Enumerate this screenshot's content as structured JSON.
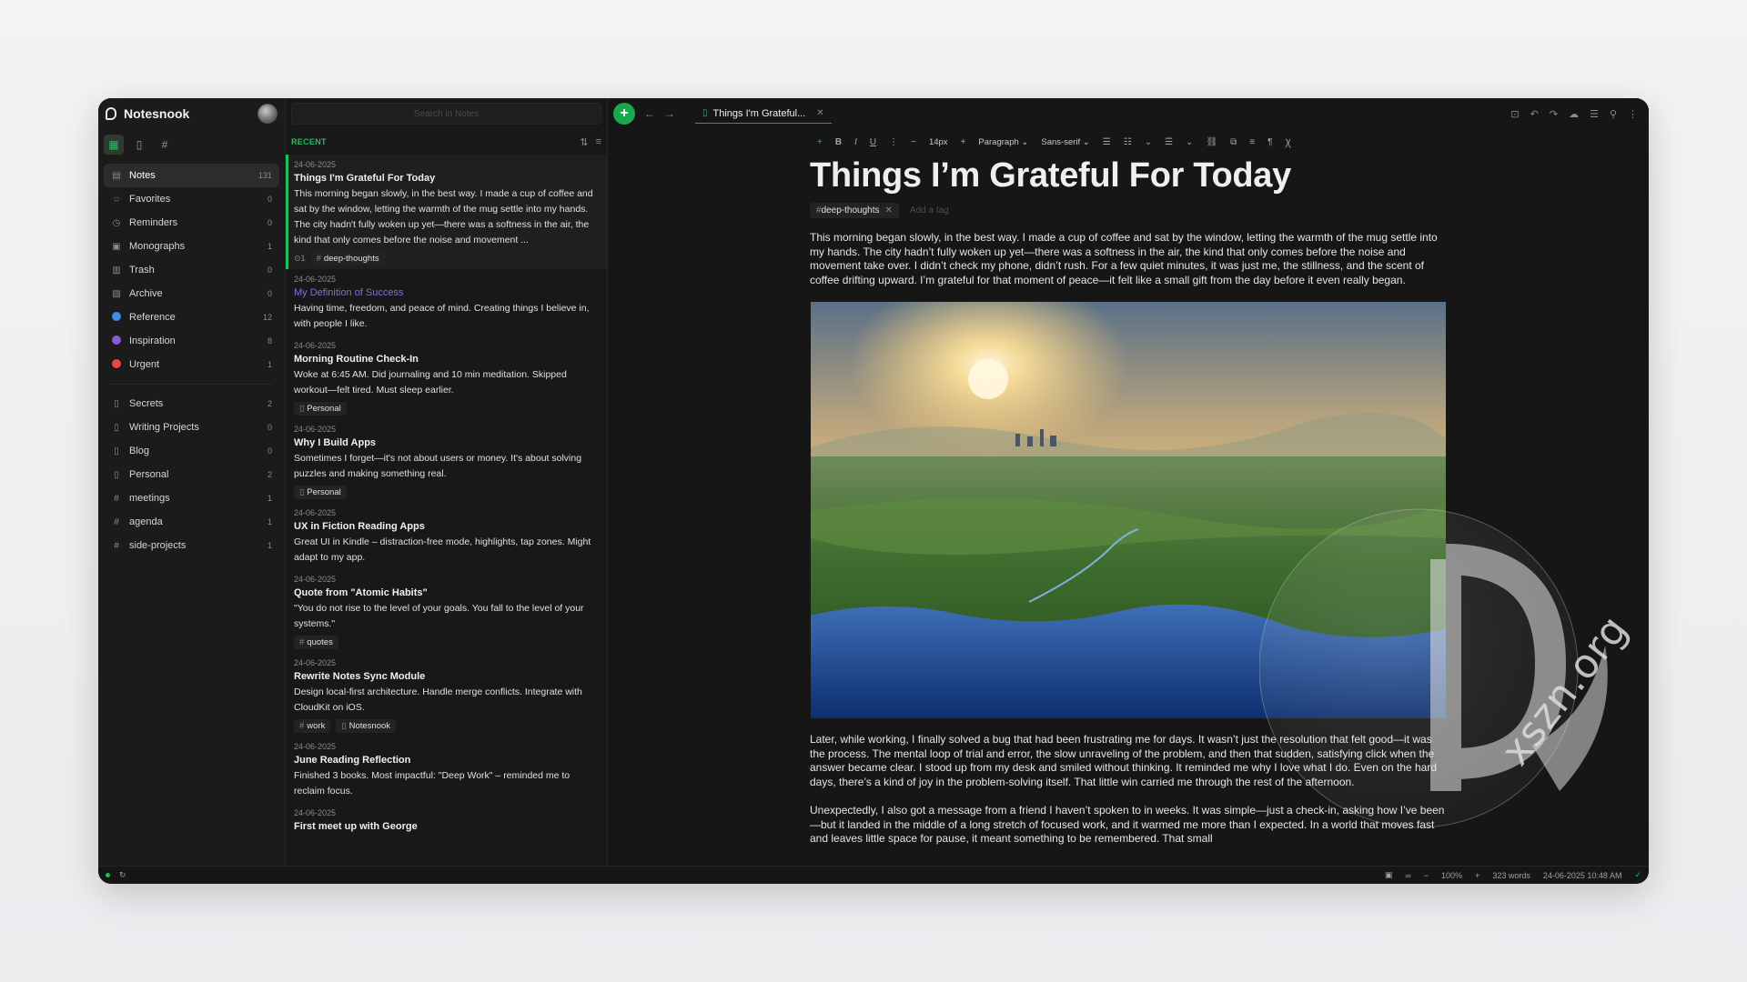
{
  "app": {
    "name": "Notesnook"
  },
  "sidebar": {
    "items": [
      {
        "label": "Notes",
        "count": "131",
        "icon": "note-icon"
      },
      {
        "label": "Favorites",
        "count": "0",
        "icon": "star-icon"
      },
      {
        "label": "Reminders",
        "count": "0",
        "icon": "clock-icon"
      },
      {
        "label": "Monographs",
        "count": "1",
        "icon": "monograph-icon"
      },
      {
        "label": "Trash",
        "count": "0",
        "icon": "trash-icon"
      },
      {
        "label": "Archive",
        "count": "0",
        "icon": "archive-icon"
      }
    ],
    "colors": [
      {
        "label": "Reference",
        "count": "12",
        "color": "#3b8ee8"
      },
      {
        "label": "Inspiration",
        "count": "8",
        "color": "#8b5cd6"
      },
      {
        "label": "Urgent",
        "count": "1",
        "color": "#e84545"
      }
    ],
    "notebooks": [
      {
        "label": "Secrets",
        "count": "2"
      },
      {
        "label": "Writing Projects",
        "count": "0"
      },
      {
        "label": "Blog",
        "count": "0"
      },
      {
        "label": "Personal",
        "count": "2"
      }
    ],
    "tags": [
      {
        "label": "meetings",
        "count": "1"
      },
      {
        "label": "agenda",
        "count": "1"
      },
      {
        "label": "side-projects",
        "count": "1"
      }
    ]
  },
  "notelist": {
    "search_placeholder": "Search in Notes",
    "section": "RECENT",
    "notes": [
      {
        "date": "24-06-2025",
        "title": "Things I'm Grateful For Today",
        "body": "This morning began slowly, in the best way. I made a cup of coffee and sat by the window, letting the warmth of the mug settle into my hands. The city hadn't fully woken up yet—there was a softness in the air, the kind that only comes before the noise and movement ...",
        "meta": "1",
        "tags": [
          "deep-thoughts"
        ]
      },
      {
        "date": "24-06-2025",
        "title": "My Definition of Success",
        "body": "Having time, freedom, and peace of mind. Creating things I believe in, with people I like.",
        "tags": []
      },
      {
        "date": "24-06-2025",
        "title": "Morning Routine Check-In",
        "body": "Woke at 6:45 AM. Did journaling and 10 min meditation. Skipped workout—felt tired. Must sleep earlier.",
        "notebooks": [
          "Personal"
        ]
      },
      {
        "date": "24-06-2025",
        "title": "Why I Build Apps",
        "body": "Sometimes I forget—it's not about users or money. It's about solving puzzles and making something real.",
        "notebooks": [
          "Personal"
        ]
      },
      {
        "date": "24-06-2025",
        "title": "UX in Fiction Reading Apps",
        "body": "Great UI in Kindle – distraction-free mode, highlights, tap zones. Might adapt to my app."
      },
      {
        "date": "24-06-2025",
        "title": "Quote from \"Atomic Habits\"",
        "body": "\"You do not rise to the level of your goals. You fall to the level of your systems.\"",
        "tags": [
          "quotes"
        ]
      },
      {
        "date": "24-06-2025",
        "title": "Rewrite Notes Sync Module",
        "body": "Design local-first architecture. Handle merge conflicts. Integrate with CloudKit on iOS.",
        "tags": [
          "work"
        ],
        "notebooks": [
          "Notesnook"
        ]
      },
      {
        "date": "24-06-2025",
        "title": "June Reading Reflection",
        "body": "Finished 3 books. Most impactful: \"Deep Work\" – reminded me to reclaim focus."
      },
      {
        "date": "24-06-2025",
        "title": "First meet up with George",
        "body": ""
      }
    ]
  },
  "editor": {
    "tab_title": "Things I'm Grateful...",
    "toolbar": {
      "font_size": "14px",
      "block": "Paragraph",
      "font": "Sans-serif"
    },
    "title": "Things I’m Grateful For Today",
    "tag": "deep-thoughts",
    "add_tag_placeholder": "Add a tag",
    "paragraphs": [
      "This morning began slowly, in the best way. I made a cup of coffee and sat by the window, letting the warmth of the mug settle into my hands. The city hadn’t fully woken up yet—there was a softness in the air, the kind that only comes before the noise and movement take over. I didn’t check my phone, didn’t rush. For a few quiet minutes, it was just me, the stillness, and the scent of coffee drifting upward. I’m grateful for that moment of peace—it felt like a small gift from the day before it even really began.",
      "Later, while working, I finally solved a bug that had been frustrating me for days. It wasn’t just the resolution that felt good—it was the process. The mental loop of trial and error, the slow unraveling of the problem, and then that sudden, satisfying click when the answer became clear. I stood up from my desk and smiled without thinking. It reminded me why I love what I do. Even on the hard days, there’s a kind of joy in the problem-solving itself. That little win carried me through the rest of the afternoon.",
      "Unexpectedly, I also got a message from a friend I haven’t spoken to in weeks. It was simple—just a check-in, asking how I’ve been—but it landed in the middle of a long stretch of focused work, and it warmed me more than I expected. In a world that moves fast and leaves little space for pause, it meant something to be remembered. That small"
    ]
  },
  "statusbar": {
    "zoom": "100%",
    "words": "323 words",
    "timestamp": "24-06-2025 10:48 AM"
  },
  "watermark": "xszn.org",
  "colors": {
    "accent": "#1fbf5f",
    "bg": "#161616"
  }
}
